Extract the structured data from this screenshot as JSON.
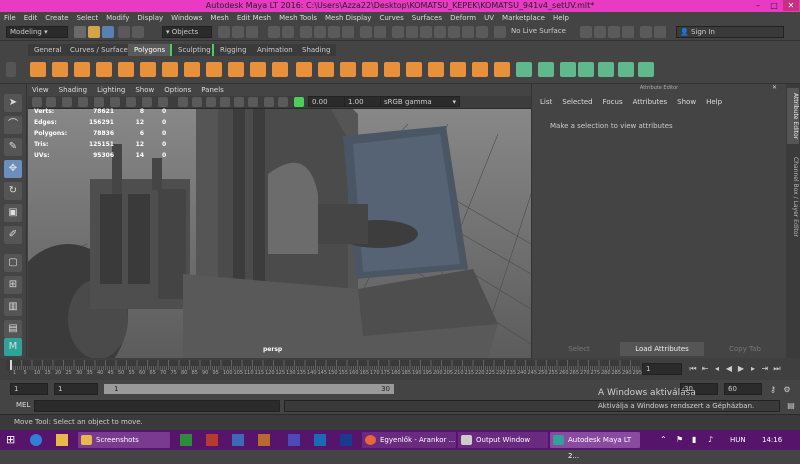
{
  "window": {
    "title": "Autodesk Maya LT 2016: C:\\Users\\Azza22\\Desktop\\KOMATSU_KEPEK\\KOMATSU_941v4_setUV.mlt*",
    "min": "–",
    "max": "□",
    "close": "✕"
  },
  "menu": [
    "File",
    "Edit",
    "Create",
    "Select",
    "Modify",
    "Display",
    "Windows",
    "Mesh",
    "Edit Mesh",
    "Mesh Tools",
    "Mesh Display",
    "Curves",
    "Surfaces",
    "Deform",
    "UV",
    "Marketplace",
    "Help"
  ],
  "status": {
    "mode": "Modeling",
    "selmask": "Objects",
    "live": "No Live Surface",
    "signin": "Sign In"
  },
  "shelf_tabs": [
    "General",
    "Curves / Surfaces",
    "Polygons",
    "Sculpting",
    "Rigging",
    "Animation",
    "Shading"
  ],
  "active_tab": "Polygons",
  "viewport": {
    "menu": [
      "View",
      "Shading",
      "Lighting",
      "Show",
      "Options",
      "Panels"
    ],
    "field1": "0.00",
    "field2": "1.00",
    "colorspace": "sRGB gamma",
    "camera": "persp",
    "stats": [
      {
        "k": "Verts:",
        "v": "78621",
        "a": "8",
        "b": "0"
      },
      {
        "k": "Edges:",
        "v": "156291",
        "a": "12",
        "b": "0"
      },
      {
        "k": "Polygons:",
        "v": "78836",
        "a": "6",
        "b": "0"
      },
      {
        "k": "Tris:",
        "v": "125151",
        "a": "12",
        "b": "0"
      },
      {
        "k": "UVs:",
        "v": "95306",
        "a": "14",
        "b": "0"
      }
    ]
  },
  "attr": {
    "title": "Attribute Editor",
    "menu": [
      "List",
      "Selected",
      "Focus",
      "Attributes",
      "Show",
      "Help"
    ],
    "message": "Make a selection to view attributes",
    "buttons": [
      "Select",
      "Load Attributes",
      "Copy Tab"
    ]
  },
  "side_tabs": [
    "Attribute Editor",
    "Channel Box / Layer Editor"
  ],
  "timeline": {
    "ticks": [
      "1",
      "5",
      "10",
      "15",
      "20",
      "25",
      "30",
      "35",
      "40",
      "45",
      "50",
      "55",
      "60",
      "65",
      "70",
      "75",
      "80",
      "85",
      "90",
      "95",
      "100",
      "105",
      "110",
      "115",
      "120",
      "125",
      "130",
      "135",
      "140",
      "145",
      "150",
      "155",
      "160",
      "165",
      "170",
      "175",
      "180",
      "185",
      "190",
      "195",
      "200",
      "205",
      "210",
      "215",
      "220",
      "225",
      "230",
      "235",
      "240",
      "245",
      "250",
      "255",
      "260",
      "265",
      "270",
      "275",
      "280",
      "285",
      "290",
      "295",
      "300"
    ],
    "current": "1"
  },
  "range": {
    "start": "1",
    "start2": "1",
    "slider_start": "1",
    "slider_end": "30",
    "end": "30",
    "end2": "60"
  },
  "mel": {
    "label": "MEL"
  },
  "watermark": {
    "line1": "A Windows aktiválása",
    "line2": "Aktiválja a Windows rendszert a Gépházban."
  },
  "help": "Move Tool: Select an object to move.",
  "taskbar": {
    "items": [
      {
        "label": "Screenshots",
        "color": "#e8b84a"
      },
      {
        "label": "Egyenlők - Arankor ...",
        "color": "#e8663a"
      },
      {
        "label": "Output Window",
        "color": "#cccccc"
      },
      {
        "label": "Autodesk Maya LT 2...",
        "color": "#2fa39a"
      }
    ],
    "lang": "HUN",
    "time": "14:16"
  },
  "colors": {
    "accent": "#e83ac3",
    "taskbar": "#56146b",
    "shelf_orange": "#e8913a",
    "shelf_green": "#5fb98c"
  }
}
